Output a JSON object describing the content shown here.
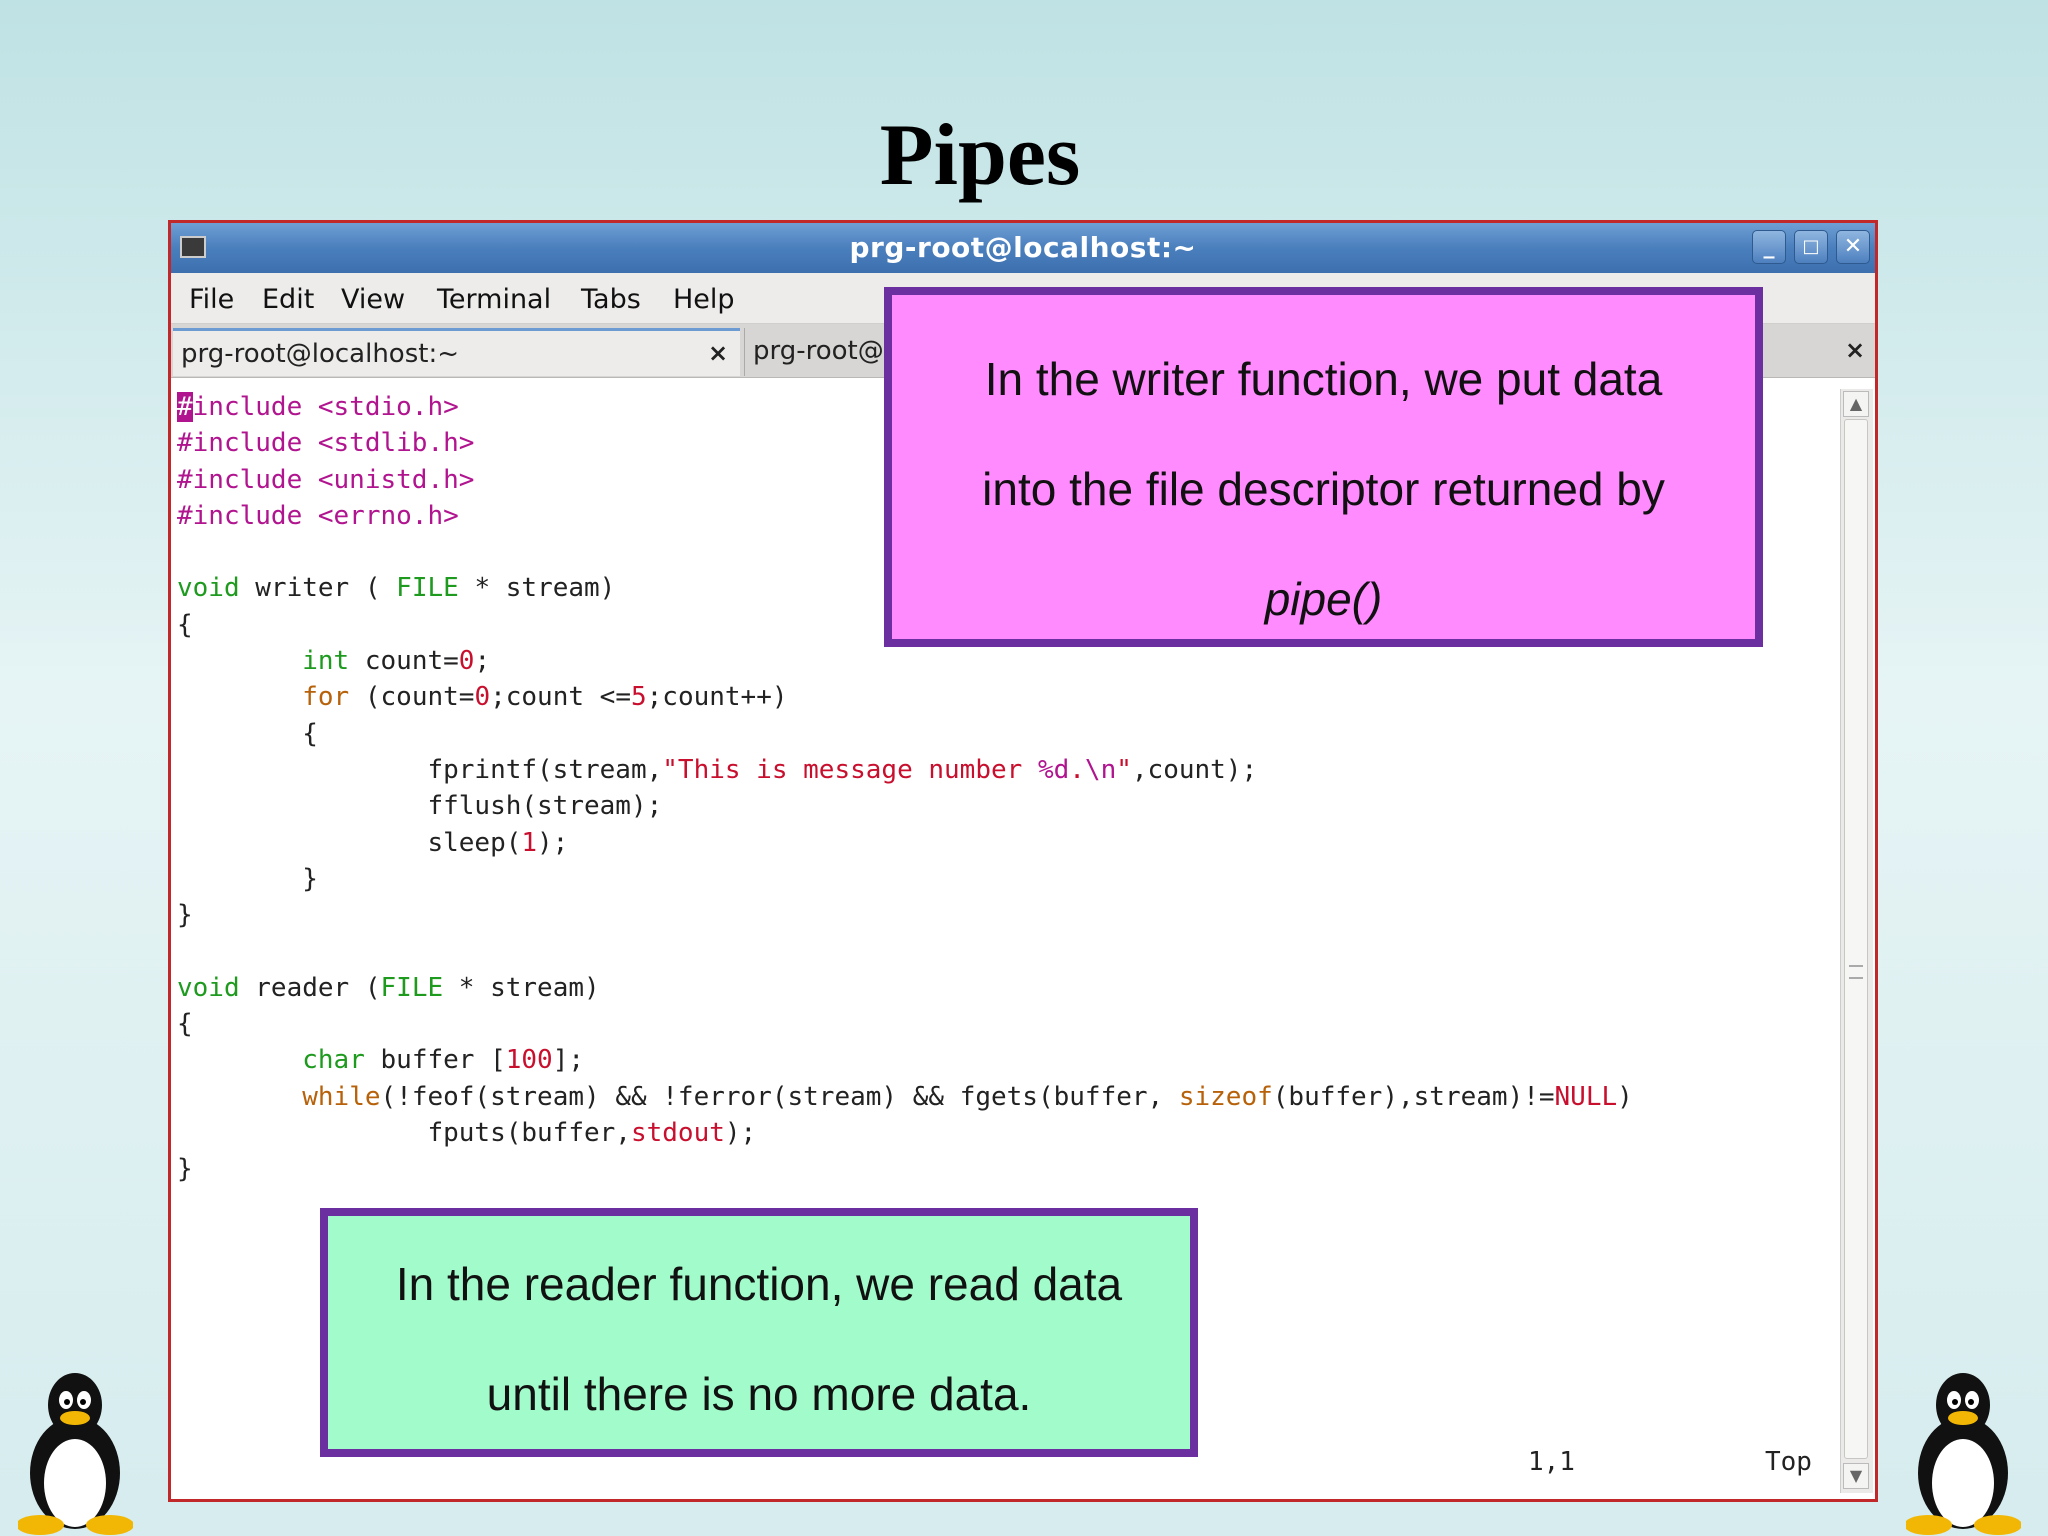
{
  "slide": {
    "title": "Pipes"
  },
  "window": {
    "title": "prg-root@localhost:~",
    "menu": [
      "File",
      "Edit",
      "View",
      "Terminal",
      "Tabs",
      "Help"
    ],
    "tabs": [
      {
        "label": "prg-root@localhost:~",
        "close": "×"
      },
      {
        "label": "prg-root@",
        "close": "×"
      }
    ],
    "controls": {
      "minimize": "_",
      "maximize": "□",
      "close": "✕"
    }
  },
  "code": [
    "#include <stdio.h>",
    "#include <stdlib.h>",
    "#include <unistd.h>",
    "#include <errno.h>",
    "",
    "void writer ( FILE * stream)",
    "{",
    "        int count=0;",
    "        for (count=0;count <=5;count++)",
    "        {",
    "                fprintf(stream,\"This is message number %d.\\n\",count);",
    "                fflush(stream);",
    "                sleep(1);",
    "        }",
    "}",
    "",
    "void reader (FILE * stream)",
    "{",
    "        char buffer [100];",
    "        while(!feof(stream) && !ferror(stream) && fgets(buffer, sizeof(buffer),stream)!=NULL)",
    "                fputs(buffer,stdout);",
    "}"
  ],
  "status": {
    "position": "1,1",
    "scroll": "Top"
  },
  "callouts": {
    "writer": {
      "line1": "In the writer function, we put data",
      "line2": "into the file descriptor returned by",
      "line3": "pipe()"
    },
    "reader": {
      "line1": "In the reader function, we read data",
      "line2": "until there is no more data."
    }
  },
  "colors": {
    "preprocessor": "#b1148f",
    "type": "#1e9a1e",
    "keyword": "#b7620a",
    "literal": "#c8102e",
    "callout_border": "#6b2fa0",
    "callout_pink": "#ff8bff",
    "callout_green": "#a2fbca"
  }
}
